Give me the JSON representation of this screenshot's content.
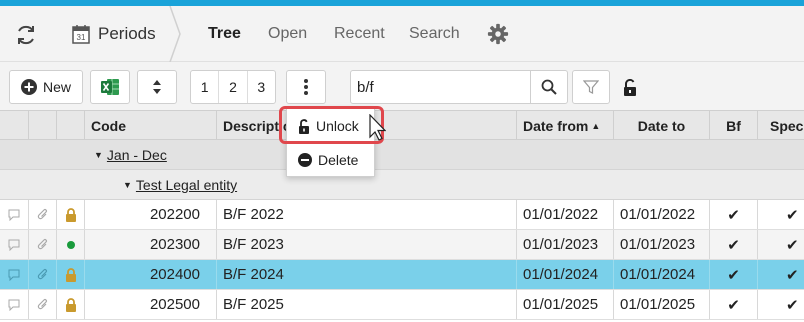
{
  "nav": {
    "periods_label": "Periods",
    "calendar_day": "31",
    "tabs": [
      "Tree",
      "Open",
      "Recent",
      "Search"
    ]
  },
  "toolbar": {
    "new_label": "New",
    "levels": [
      "1",
      "2",
      "3"
    ],
    "search_value": "b/f"
  },
  "columns": {
    "code": "Code",
    "description": "Description",
    "date_from": "Date from",
    "date_to": "Date to",
    "bf": "Bf",
    "spec": "Spec"
  },
  "groups": {
    "level1": "Jan - Dec",
    "level2": "Test Legal entity"
  },
  "rows": [
    {
      "code": "202200",
      "description": "B/F 2022",
      "date_from": "01/01/2022",
      "date_to": "01/01/2022",
      "status": "lock"
    },
    {
      "code": "202300",
      "description": "B/F 2023",
      "date_from": "01/01/2023",
      "date_to": "01/01/2023",
      "status": "open"
    },
    {
      "code": "202400",
      "description": "B/F 2024",
      "date_from": "01/01/2024",
      "date_to": "01/01/2024",
      "status": "lock"
    },
    {
      "code": "202500",
      "description": "B/F 2025",
      "date_from": "01/01/2025",
      "date_to": "01/01/2025",
      "status": "lock"
    }
  ],
  "menu": {
    "unlock_label": "Unlock",
    "delete_label": "Delete"
  },
  "icons": {
    "refresh": "refresh-icon",
    "calendar": "calendar-icon",
    "settings": "gear-icon",
    "add": "plus-circle-icon",
    "excel": "excel-icon",
    "sort": "sort-icon",
    "more": "more-vertical-icon",
    "search": "search-icon",
    "filter": "filter-icon",
    "lock": "lock-icon",
    "unlock": "unlock-icon",
    "delete": "minus-circle-icon",
    "comment": "comment-icon",
    "attachment": "paperclip-icon",
    "check": "check-icon"
  },
  "colors": {
    "accent": "#1aa3d9",
    "selected_row": "#7ad0ea",
    "lock": "#c99a2e",
    "open_dot": "#1a9b3c",
    "highlight": "#e0474c"
  }
}
